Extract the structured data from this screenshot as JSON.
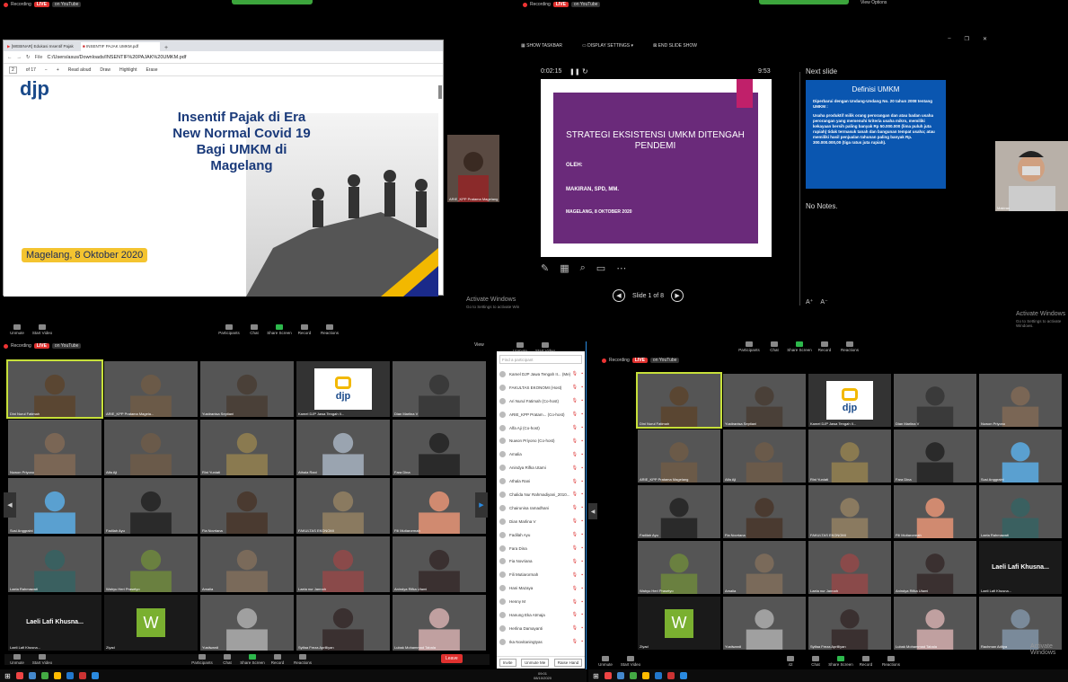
{
  "top_left": {
    "rec": "Recording",
    "live": "LIVE",
    "yt": "on YouTube"
  },
  "top_right": {
    "rec": "Recording",
    "live": "LIVE",
    "yt": "on YouTube",
    "view_options": "View Options"
  },
  "browser": {
    "tabs": [
      "[WEBINAR] Edukasi Insentif Pajak",
      "INSENTIF PAJAK UMKM.pdf"
    ],
    "url": "C:/Users/asus/Downloads/INSENTIF%20PAJAK%20UMKM.pdf",
    "file_label": "File",
    "page": "2",
    "of": "of 17",
    "read_aloud": "Read aloud",
    "draw": "Draw",
    "highlight": "Highlight",
    "erase": "Erase"
  },
  "slide1": {
    "logo": "djp",
    "title_lines": [
      "Insentif Pajak di Era",
      "New Normal Covid 19",
      "Bagi UMKM di",
      "Magelang"
    ],
    "date": "Magelang, 8 Oktober 2020"
  },
  "presenter_small_name": "ARIE_KPP Pratama Magelang",
  "activate": {
    "title": "Activate Windows",
    "sub": "Go to Settings to activate Windows."
  },
  "ppt": {
    "show_taskbar": "SHOW TASKBAR",
    "display_settings": "DISPLAY SETTINGS ▾",
    "end_show": "END SLIDE SHOW",
    "elapsed": "0:02:15",
    "clock": "9:53",
    "next_slide": "Next slide",
    "no_notes": "No Notes.",
    "slide_counter": "Slide 1 of 8",
    "slide": {
      "title": "STRATEGI EKSISTENSI UMKM DITENGAH PENDEMI",
      "oleh": "OLEH:",
      "author": "MAKIRAN, SPD, MM.",
      "date": "MAGELANG, 8 OKTOBER 2020"
    },
    "next": {
      "title": "Definisi UMKM",
      "bullet1": "Diperbarui dengan Undang-Undang No. 20 tahun 2008 tentang UMKM :",
      "bullet2": "Usaha produktif milik orang perorangan dan atau badan usaha perorangan yang memenuhi kriteria usaha mikro, memiliki kekayaan bersih paling banyak Rp 50.000.000 (lima puluh juta rupiah) tidak termasuk tanah dan bangunan tempat usaha; atau memiliki hasil penjualan tahunan paling banyak Rp. 300.000.000,00 (tiga ratus juta rupiah)."
    }
  },
  "presenter2_name": "Makiran",
  "zoom_toolbar": {
    "unmute": "Unmute",
    "start_video": "Start Video",
    "participants": "Participants",
    "participants_count": "42",
    "chat": "Chat",
    "share_screen": "Share Screen",
    "record": "Record",
    "reactions": "Reactions",
    "leave": "Leave",
    "view": "View"
  },
  "gallery_left": [
    {
      "n": "Dini Nurul Fatimah",
      "c": "#5a4632"
    },
    {
      "n": "ARIE_KPP Pratama Magela...",
      "c": "#6b5a48"
    },
    {
      "n": "Yustiranisa Septiani",
      "c": "#4a4038"
    },
    {
      "n": "Kamel DJP Jawa Tengah II...",
      "c": "#ffffff"
    },
    {
      "n": "Dian Marlina V",
      "c": "#3a3a3a"
    },
    {
      "n": "Nuwon Priyono",
      "c": "#7a6655"
    },
    {
      "n": "Alfa Aji",
      "c": "#6a5a4a"
    },
    {
      "n": "Rini Yuniati",
      "c": "#8a7a50"
    },
    {
      "n": "Athala Rani",
      "c": "#9aa4b0"
    },
    {
      "n": "Fara Dina",
      "c": "#2a2a2a"
    },
    {
      "n": "Susi Anggraini",
      "c": "#5aa0d0"
    },
    {
      "n": "Fadilah Ayu",
      "c": "#2a2a2a"
    },
    {
      "n": "Fia Novriana",
      "c": "#4a3a30"
    },
    {
      "n": "FAKULTAS EKONOMI",
      "c": "#8a7a60"
    },
    {
      "n": "Fili Mutiarormah",
      "c": "#d08a70"
    },
    {
      "n": "Laela Rahmawati",
      "c": "#3a6060"
    },
    {
      "n": "Wahyu Heri Prasetyo",
      "c": "#6a8040"
    },
    {
      "n": "Amalia",
      "c": "#7a6a5a"
    },
    {
      "n": "Laela nur Jannah",
      "c": "#8a4a4a"
    },
    {
      "n": "Anindya Rifka Utami",
      "c": "#3a3030"
    },
    {
      "n": "Laeli Lafi Khusna...",
      "c": "#1a1a1a",
      "big": true
    },
    {
      "n": "Ziyad",
      "c": "#1a1a1a",
      "w": true
    },
    {
      "n": "Yustiwardi",
      "c": "#a0a0a0"
    },
    {
      "n": "Syifaa Freza Aprilliyan",
      "c": "#3a3030"
    },
    {
      "n": "Lubak Mohammad Tabala",
      "c": "#c0a0a0"
    }
  ],
  "participants": {
    "search": "Find a participant",
    "list": [
      "Kamel DJP Jawa Tengah II... (Me)",
      "FAKULTAS EKONOMI (Host)",
      "Ari Nurul Fatimah (Co-host)",
      "ARIE_KPP Pratam... (Co-host)",
      "Alfa Aji (Co-host)",
      "Nuwon Priyono (Co-host)",
      "Amalia",
      "Anindya Rifka Utami",
      "Athala Rani",
      "Chalida Nur Rahmadiyani_2010...",
      "Chairunisa ramadhani",
      "Dian Marlina V",
      "Fadilah Ayu",
      "Fara Dina",
      "Fia Novriana",
      "Fili Mutiarormah",
      "Hani Mazaya",
      "Henny M",
      "Hanung Eka Atmaja",
      "Herlina Damayanti",
      "Ika Novitaningtyas"
    ],
    "invite": "Invite",
    "unmute_me": "Unmute Me",
    "raise_hand": "Raise Hand"
  },
  "gallery_right": [
    {
      "n": "Dini Nurul Fatimah",
      "c": "#5a4632"
    },
    {
      "n": "Yustiranisa Septiani",
      "c": "#4a4038"
    },
    {
      "n": "Kamel DJP Jawa Tengah II...",
      "c": "#ffffff"
    },
    {
      "n": "Dian Marlina V",
      "c": "#3a3a3a"
    },
    {
      "n": "Nuwon Priyono",
      "c": "#7a6655"
    },
    {
      "n": "ARIE_KPP Pratama Magelang",
      "c": "#6b5a48"
    },
    {
      "n": "Alfa Aji",
      "c": "#6a5a4a"
    },
    {
      "n": "Rini Yuniati",
      "c": "#8a7a50"
    },
    {
      "n": "Fara Dina",
      "c": "#2a2a2a"
    },
    {
      "n": "Susi Anggraini",
      "c": "#5aa0d0"
    },
    {
      "n": "Fadilah Ayu",
      "c": "#2a2a2a"
    },
    {
      "n": "Fia Novriana",
      "c": "#4a3a30"
    },
    {
      "n": "FAKULTAS EKONOMI",
      "c": "#8a7a60"
    },
    {
      "n": "Fili Mutiarormah",
      "c": "#d08a70"
    },
    {
      "n": "Laela Rahmawati",
      "c": "#3a6060"
    },
    {
      "n": "Wahyu Heri Prasetyo",
      "c": "#6a8040"
    },
    {
      "n": "Amalia",
      "c": "#7a6a5a"
    },
    {
      "n": "Laela nur Jannah",
      "c": "#8a4a4a"
    },
    {
      "n": "Anindya Rifka Utami",
      "c": "#3a3030"
    },
    {
      "n": "Laeli Lafi Khusna...",
      "c": "#1a1a1a",
      "big": true
    },
    {
      "n": "Ziyad",
      "c": "#1a1a1a",
      "w": true
    },
    {
      "n": "Yustiwardi",
      "c": "#a0a0a0"
    },
    {
      "n": "Syifaa Freza Aprilliyan",
      "c": "#3a3030"
    },
    {
      "n": "Lubak Mohammad Tabala",
      "c": "#c0a0a0"
    },
    {
      "n": "Rachman Aditya",
      "c": "#7a8a9a"
    }
  ],
  "clock": {
    "time": "09:01",
    "date": "08/10/2020"
  },
  "w_letter": "W",
  "colors": {
    "green": "#2db84c",
    "live": "#e0312f",
    "active": "#c7e03a",
    "slide_bg": "#6a2a7a",
    "next_bg": "#0a56b0"
  }
}
